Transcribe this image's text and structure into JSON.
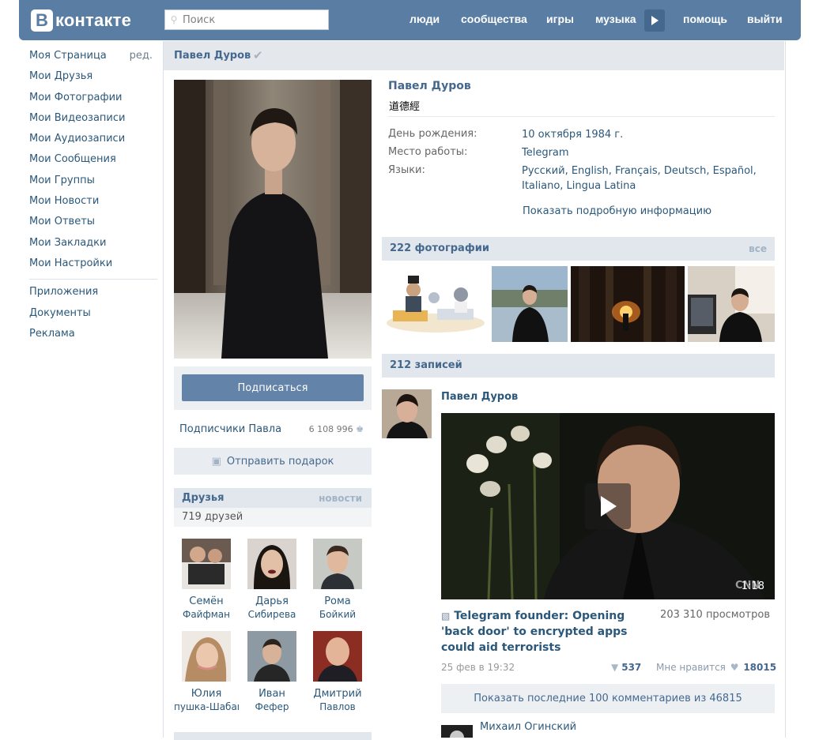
{
  "header": {
    "logo_letter": "B",
    "logo_text": "контакте",
    "search_placeholder": "Поиск",
    "nav": [
      "люди",
      "сообщества",
      "игры",
      "музыка",
      "помощь",
      "выйти"
    ],
    "brand_color": "#597da3"
  },
  "sidebar": {
    "items": [
      "Моя Страница",
      "Мои Друзья",
      "Мои Фотографии",
      "Мои Видеозаписи",
      "Мои Аудиозаписи",
      "Мои Сообщения",
      "Мои Группы",
      "Мои Новости",
      "Мои Ответы",
      "Мои Закладки",
      "Мои Настройки"
    ],
    "edit_label": "ред.",
    "extra_items": [
      "Приложения",
      "Документы",
      "Реклама"
    ]
  },
  "page": {
    "title": "Павел Дуров",
    "verified_icon": "check-icon"
  },
  "left": {
    "subscribe_label": "Подписаться",
    "followers_label": "Подписчики Павла",
    "followers_count": "6 108 996",
    "gift_label": "Отправить подарок",
    "friends_title": "Друзья",
    "friends_news": "новости",
    "friends_count": "719 друзей",
    "friends": [
      {
        "first": "Семён",
        "last": "Файфман"
      },
      {
        "first": "Дарья",
        "last": "Сибирева"
      },
      {
        "first": "Рома",
        "last": "Бойкий"
      },
      {
        "first": "Юлия",
        "last": "пушка-Шабаш"
      },
      {
        "first": "Иван",
        "last": "Фефер"
      },
      {
        "first": "Дмитрий",
        "last": "Павлов"
      }
    ]
  },
  "profile": {
    "name": "Павел Дуров",
    "status": "道德經",
    "info": [
      {
        "label": "День рождения:",
        "value": "10 октября 1984 г."
      },
      {
        "label": "Место работы:",
        "value": "Telegram"
      },
      {
        "label": "Языки:",
        "value": "Русский, English, Français, Deutsch, Español, Italiano, Lingua Latina"
      }
    ],
    "show_more": "Показать подробную информацию"
  },
  "photos": {
    "title": "222 фотографии",
    "all_label": "все"
  },
  "wall": {
    "title": "212 записей",
    "post": {
      "author": "Павел Дуров",
      "video_title": "Telegram founder: Opening 'back door' to encrypted apps could aid terrorists",
      "video_views": "203 310 просмотров",
      "video_duration": "1:18",
      "date": "25 фев в 19:32",
      "shares": "537",
      "like_label": "Мне нравится",
      "likes": "18015",
      "show_comments": "Показать последние 100 комментариев из 46815",
      "commenter": "Михаил Огинский"
    }
  }
}
